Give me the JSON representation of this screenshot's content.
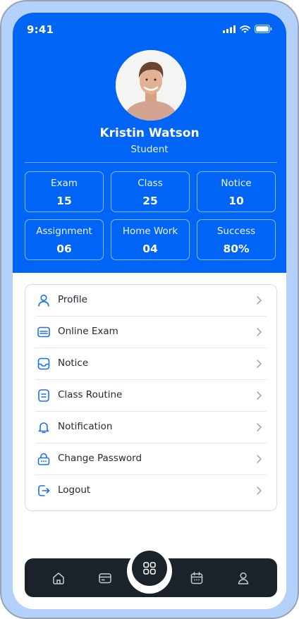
{
  "status_bar": {
    "time": "9:41"
  },
  "profile": {
    "name": "Kristin Watson",
    "role": "Student"
  },
  "stats": [
    {
      "label": "Exam",
      "value": "15"
    },
    {
      "label": "Class",
      "value": "25"
    },
    {
      "label": "Notice",
      "value": "10"
    },
    {
      "label": "Assignment",
      "value": "06"
    },
    {
      "label": "Home Work",
      "value": "04"
    },
    {
      "label": "Success",
      "value": "80%"
    }
  ],
  "menu": [
    {
      "label": "Profile",
      "icon": "user-icon"
    },
    {
      "label": "Online Exam",
      "icon": "exam-card-icon"
    },
    {
      "label": "Notice",
      "icon": "notice-icon"
    },
    {
      "label": "Class Routine",
      "icon": "routine-icon"
    },
    {
      "label": "Notification",
      "icon": "bell-icon"
    },
    {
      "label": "Change Password",
      "icon": "lock-icon"
    },
    {
      "label": "Logout",
      "icon": "logout-icon"
    }
  ],
  "tab_bar": {
    "tabs": [
      "home-icon",
      "wallet-icon",
      "grid-icon",
      "calendar-icon",
      "person-icon"
    ]
  },
  "colors": {
    "primary": "#0064f7",
    "frame": "#b3d1fb",
    "tab_bar": "#1c2229",
    "text": "#222a33"
  }
}
